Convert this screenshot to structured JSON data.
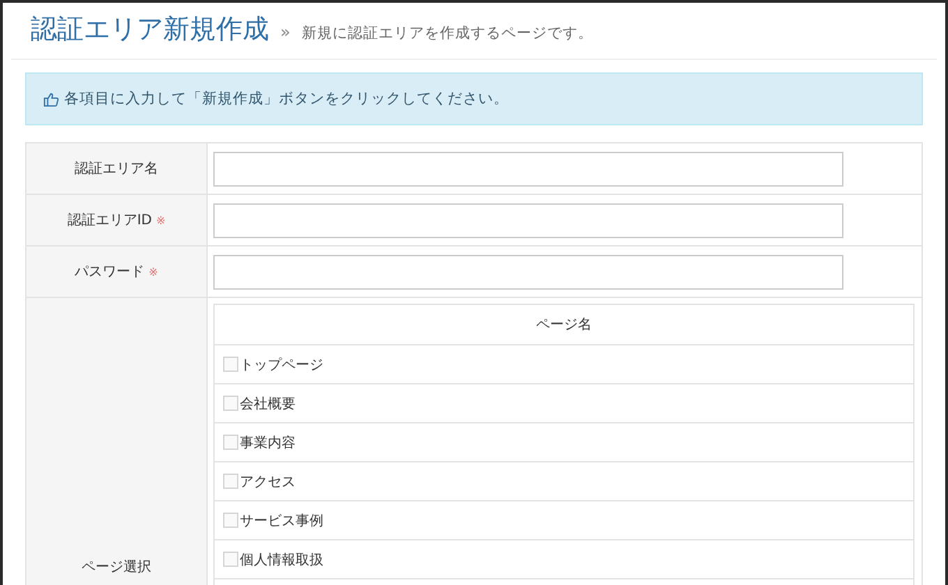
{
  "header": {
    "title": "認証エリア新規作成",
    "breadcrumb_mark": "»",
    "subtitle": "新規に認証エリアを作成するページです。"
  },
  "notice": {
    "text": "各項目に入力して「新規作成」ボタンをクリックしてください。"
  },
  "fields": [
    {
      "label": "認証エリア名"
    },
    {
      "label": "認証エリアID",
      "mark": "※"
    },
    {
      "label": "パスワード",
      "mark": "※"
    }
  ],
  "page_select": {
    "label": "ページ選択",
    "column": "ページ名",
    "pages": [
      {
        "name": "トップページ",
        "checked": false
      },
      {
        "name": "会社概要",
        "checked": false
      },
      {
        "name": "事業内容",
        "checked": false
      },
      {
        "name": "アクセス",
        "checked": false
      },
      {
        "name": "サービス事例",
        "checked": false
      },
      {
        "name": "個人情報取扱",
        "checked": false
      }
    ]
  }
}
